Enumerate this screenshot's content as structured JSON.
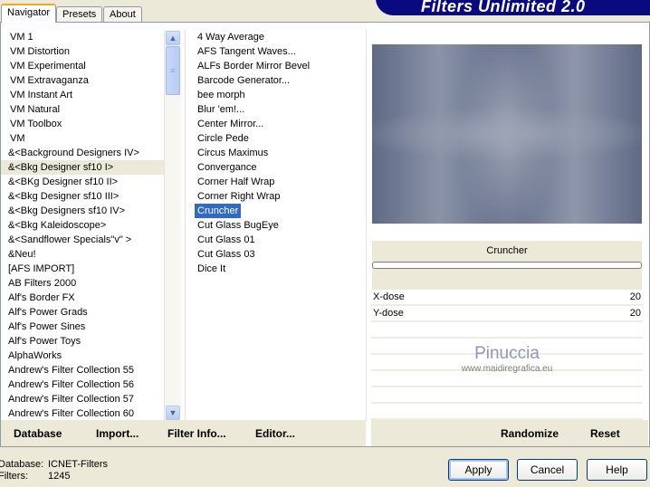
{
  "title": "Filters Unlimited 2.0",
  "tabs": [
    {
      "label": "Navigator"
    },
    {
      "label": "Presets"
    },
    {
      "label": "About"
    }
  ],
  "categories": [
    "VM 1",
    "VM Distortion",
    "VM Experimental",
    "VM Extravaganza",
    "VM Instant Art",
    "VM Natural",
    "VM Toolbox",
    "VM",
    "&<Background Designers IV>",
    "&<Bkg Designer sf10 I>",
    "&<BKg Designer sf10 II>",
    "&<Bkg Designer sf10 III>",
    "&<Bkg Designers sf10 IV>",
    "&<Bkg Kaleidoscope>",
    "&<Sandflower Specials\"v\" >",
    "&Neu!",
    "[AFS IMPORT]",
    "AB Filters 2000",
    "Alf's Border FX",
    "Alf's Power Grads",
    "Alf's Power Sines",
    "Alf's Power Toys",
    "AlphaWorks",
    "Andrew's Filter Collection 55",
    "Andrew's Filter Collection 56",
    "Andrew's Filter Collection 57",
    "Andrew's Filter Collection 60"
  ],
  "selected_category": "&<Bkg Designer sf10 I>",
  "filters": [
    "4 Way Average",
    "AFS Tangent Waves...",
    "ALFs Border Mirror Bevel",
    "Barcode Generator...",
    "bee morph",
    "Blur 'em!...",
    "Center Mirror...",
    "Circle Pede",
    "Circus Maximus",
    "Convergance",
    "Corner Half Wrap",
    "Corner Right Wrap",
    "Cruncher",
    "Cut Glass  BugEye",
    "Cut Glass 01",
    "Cut Glass 03",
    "Dice It"
  ],
  "selected_filter": "Cruncher",
  "preview": {
    "filter_name": "Cruncher"
  },
  "params": [
    {
      "label": "X-dose",
      "value": "20"
    },
    {
      "label": "Y-dose",
      "value": "20"
    }
  ],
  "watermark": {
    "name": "Pinuccia",
    "url": "www.maidiregrafica.eu"
  },
  "toolbar": {
    "database": "Database",
    "import": "Import...",
    "filter_info": "Filter Info...",
    "editor": "Editor...",
    "randomize": "Randomize",
    "reset": "Reset"
  },
  "status": {
    "database_label": "Database:",
    "database_value": "ICNET-Filters",
    "filters_label": "Filters:",
    "filters_value": "1245"
  },
  "buttons": {
    "apply": "Apply",
    "cancel": "Cancel",
    "help": "Help"
  }
}
